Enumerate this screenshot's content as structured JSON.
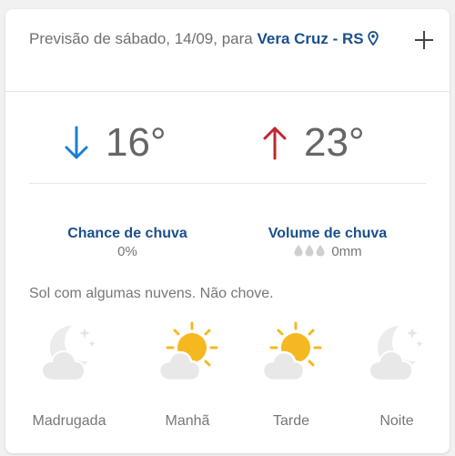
{
  "forecast": {
    "title_prefix": "Previsão de sábado, 14/09, para",
    "city": "Vera Cruz - RS",
    "min_temp": "16°",
    "max_temp": "23°",
    "rain_chance_label": "Chance de chuva",
    "rain_chance_value": "0%",
    "rain_volume_label": "Volume de chuva",
    "rain_volume_value": "0mm",
    "description": "Sol com algumas nuvens. Não chove.",
    "periods": [
      {
        "name": "Madrugada",
        "icon": "moon-cloud-icon"
      },
      {
        "name": "Manhã",
        "icon": "sun-cloud-icon"
      },
      {
        "name": "Tarde",
        "icon": "sun-cloud-icon"
      },
      {
        "name": "Noite",
        "icon": "moon-cloud-icon"
      }
    ]
  },
  "colors": {
    "accent": "#1b4f8c",
    "min_arrow": "#1a7fd1",
    "max_arrow": "#c0262d",
    "sun": "#f5b820"
  }
}
